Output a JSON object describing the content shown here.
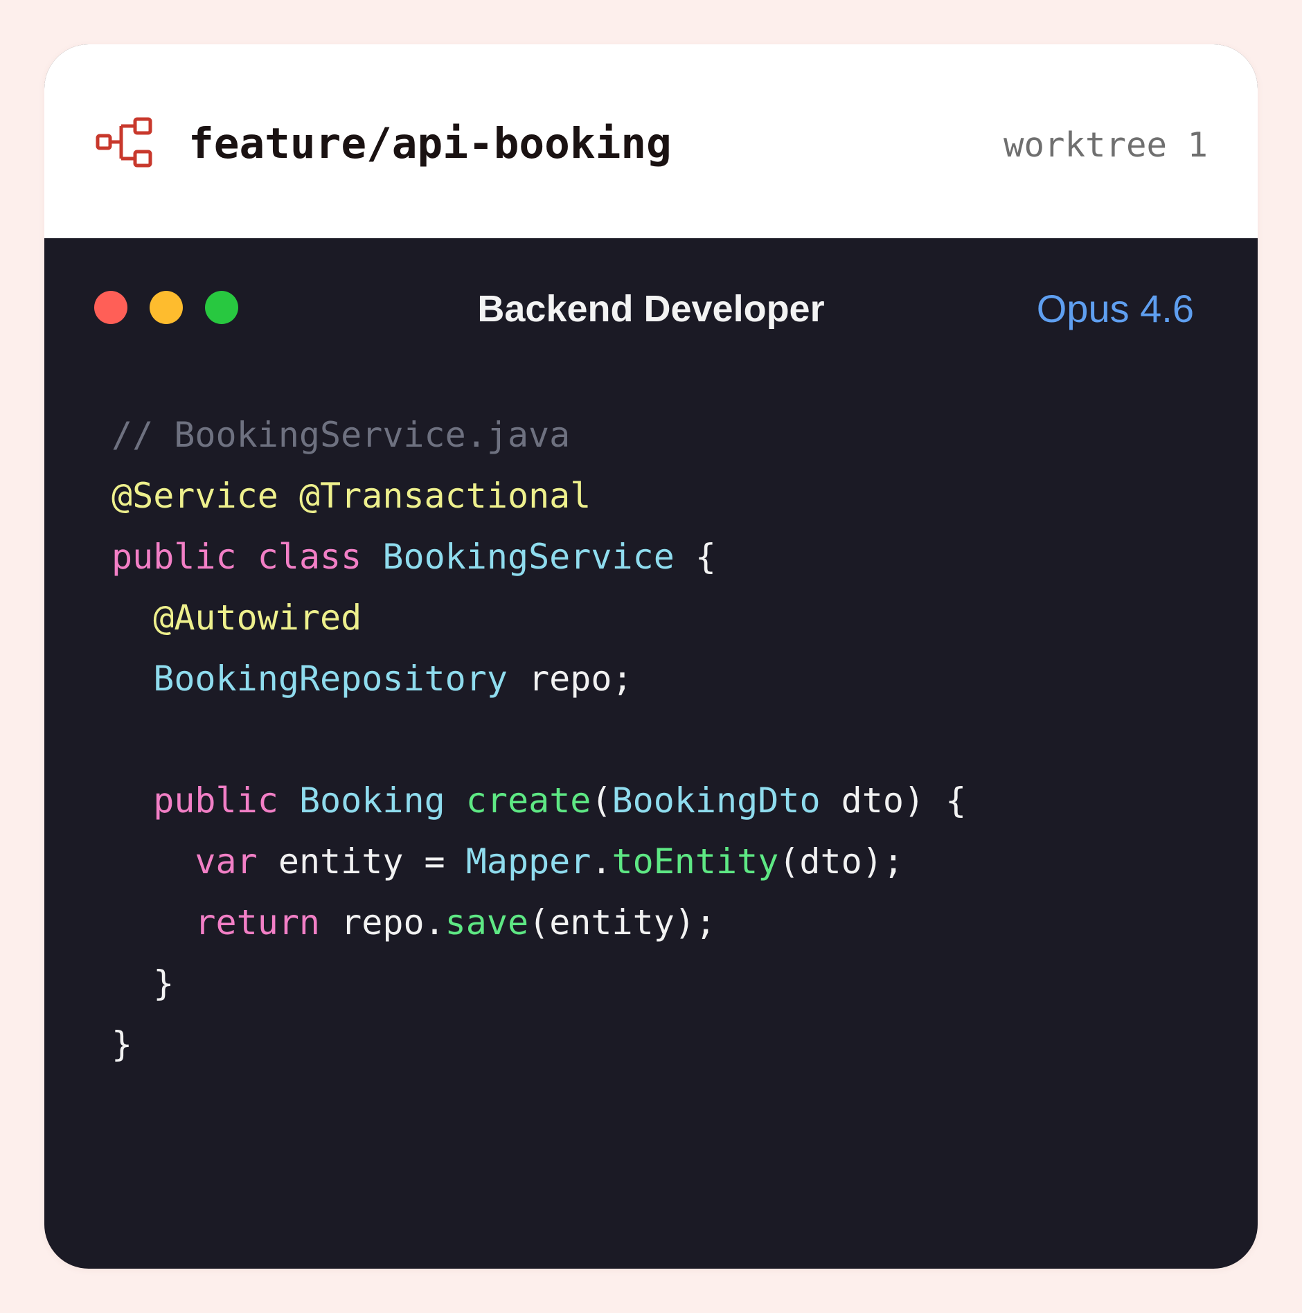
{
  "header": {
    "branch_icon": "git-branch-icon",
    "branch_name": "feature/api-booking",
    "worktree": "worktree 1"
  },
  "terminal": {
    "window_controls": [
      "close",
      "minimize",
      "maximize"
    ],
    "title": "Backend Developer",
    "model": "Opus 4.6"
  },
  "code": {
    "language": "java",
    "lines": [
      [
        {
          "t": "// BookingService.java",
          "k": "comment"
        }
      ],
      [
        {
          "t": "@Service",
          "k": "annotation"
        },
        {
          "t": " ",
          "k": "plain"
        },
        {
          "t": "@Transactional",
          "k": "annotation"
        }
      ],
      [
        {
          "t": "public",
          "k": "keyword"
        },
        {
          "t": " ",
          "k": "plain"
        },
        {
          "t": "class",
          "k": "keyword"
        },
        {
          "t": " ",
          "k": "plain"
        },
        {
          "t": "BookingService",
          "k": "type"
        },
        {
          "t": " {",
          "k": "plain"
        }
      ],
      [
        {
          "t": "  ",
          "k": "plain"
        },
        {
          "t": "@Autowired",
          "k": "annotation"
        }
      ],
      [
        {
          "t": "  ",
          "k": "plain"
        },
        {
          "t": "BookingRepository",
          "k": "type"
        },
        {
          "t": " repo;",
          "k": "plain"
        }
      ],
      [],
      [
        {
          "t": "  ",
          "k": "plain"
        },
        {
          "t": "public",
          "k": "keyword"
        },
        {
          "t": " ",
          "k": "plain"
        },
        {
          "t": "Booking",
          "k": "type"
        },
        {
          "t": " ",
          "k": "plain"
        },
        {
          "t": "create",
          "k": "method"
        },
        {
          "t": "(",
          "k": "plain"
        },
        {
          "t": "BookingDto",
          "k": "type"
        },
        {
          "t": " dto) {",
          "k": "plain"
        }
      ],
      [
        {
          "t": "    ",
          "k": "plain"
        },
        {
          "t": "var",
          "k": "keyword"
        },
        {
          "t": " entity = ",
          "k": "plain"
        },
        {
          "t": "Mapper",
          "k": "type"
        },
        {
          "t": ".",
          "k": "plain"
        },
        {
          "t": "toEntity",
          "k": "method"
        },
        {
          "t": "(dto);",
          "k": "plain"
        }
      ],
      [
        {
          "t": "    ",
          "k": "plain"
        },
        {
          "t": "return",
          "k": "keyword"
        },
        {
          "t": " repo.",
          "k": "plain"
        },
        {
          "t": "save",
          "k": "method"
        },
        {
          "t": "(entity);",
          "k": "plain"
        }
      ],
      [
        {
          "t": "  }",
          "k": "plain"
        }
      ],
      [
        {
          "t": "}",
          "k": "plain"
        }
      ]
    ]
  },
  "colors": {
    "page_background": "#fdefec",
    "header_background": "#ffffff",
    "terminal_background": "#1b1a25",
    "branch_icon": "#c8382c",
    "close": "#ff5f57",
    "minimize": "#febc2e",
    "maximize": "#28c840",
    "model_label": "#5f9ff0",
    "comment": "#6e7180",
    "annotation": "#eef08d",
    "keyword": "#f27fc6",
    "type": "#8fdcee",
    "method": "#5ee884",
    "plain": "#f2f2f2"
  }
}
